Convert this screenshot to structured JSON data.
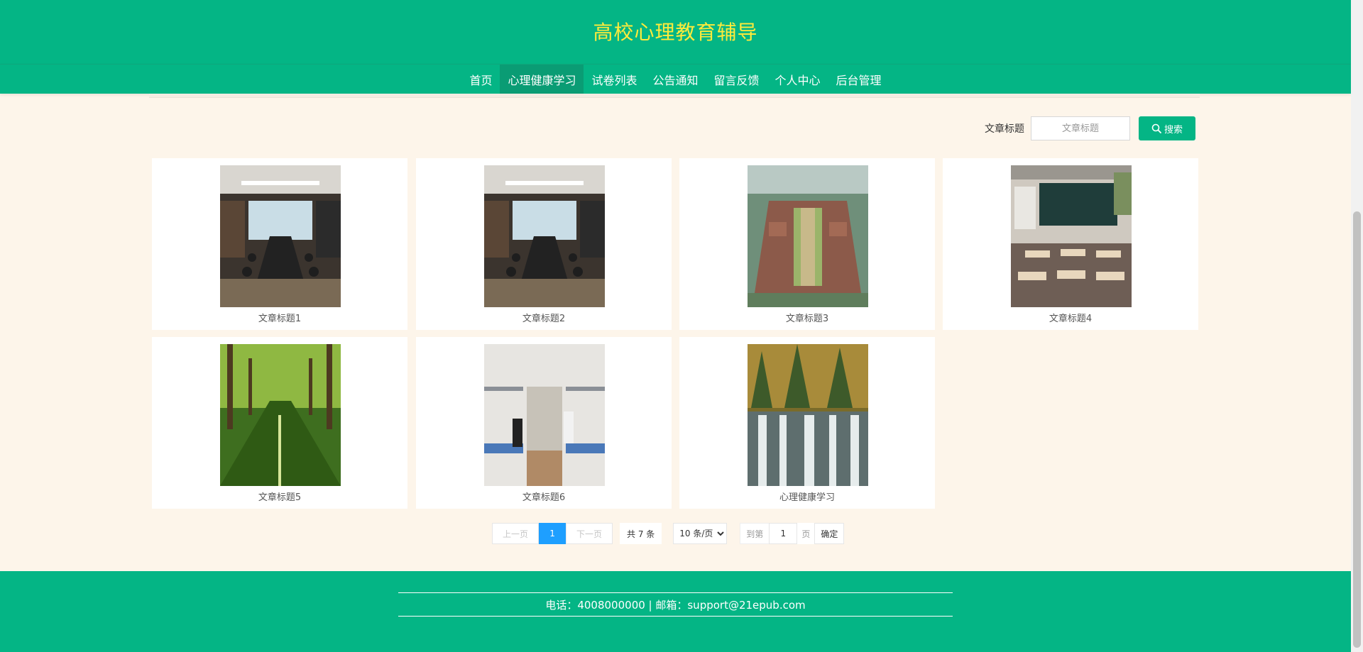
{
  "site": {
    "title": "高校心理教育辅导"
  },
  "nav": {
    "items": [
      {
        "label": "首页"
      },
      {
        "label": "心理健康学习"
      },
      {
        "label": "试卷列表"
      },
      {
        "label": "公告通知"
      },
      {
        "label": "留言反馈"
      },
      {
        "label": "个人中心"
      },
      {
        "label": "后台管理"
      }
    ],
    "active_index": 1
  },
  "search": {
    "label": "文章标题",
    "placeholder": "文章标题",
    "button_label": "搜索",
    "icon": "search-icon"
  },
  "articles": [
    {
      "title": "文章标题1",
      "image": "conference-room"
    },
    {
      "title": "文章标题2",
      "image": "conference-room"
    },
    {
      "title": "文章标题3",
      "image": "campus-aerial"
    },
    {
      "title": "文章标题4",
      "image": "classroom"
    },
    {
      "title": "文章标题5",
      "image": "tree-lined-path"
    },
    {
      "title": "文章标题6",
      "image": "dormitory"
    },
    {
      "title": "心理健康学习",
      "image": "waterfall"
    }
  ],
  "pagination": {
    "prev_label": "上一页",
    "current_page": "1",
    "next_label": "下一页",
    "total_text": "共 7 条",
    "page_size_option": "10 条/页",
    "goto_label": "到第",
    "goto_value": "1",
    "page_suffix": "页",
    "confirm_label": "确定"
  },
  "footer": {
    "contact": "电话：4008000000 | 邮箱：support@21epub.com"
  },
  "colors": {
    "primary": "#04b585",
    "title": "#ffeb3b",
    "background": "#fdf5ea",
    "page_active": "#1e9fff"
  }
}
